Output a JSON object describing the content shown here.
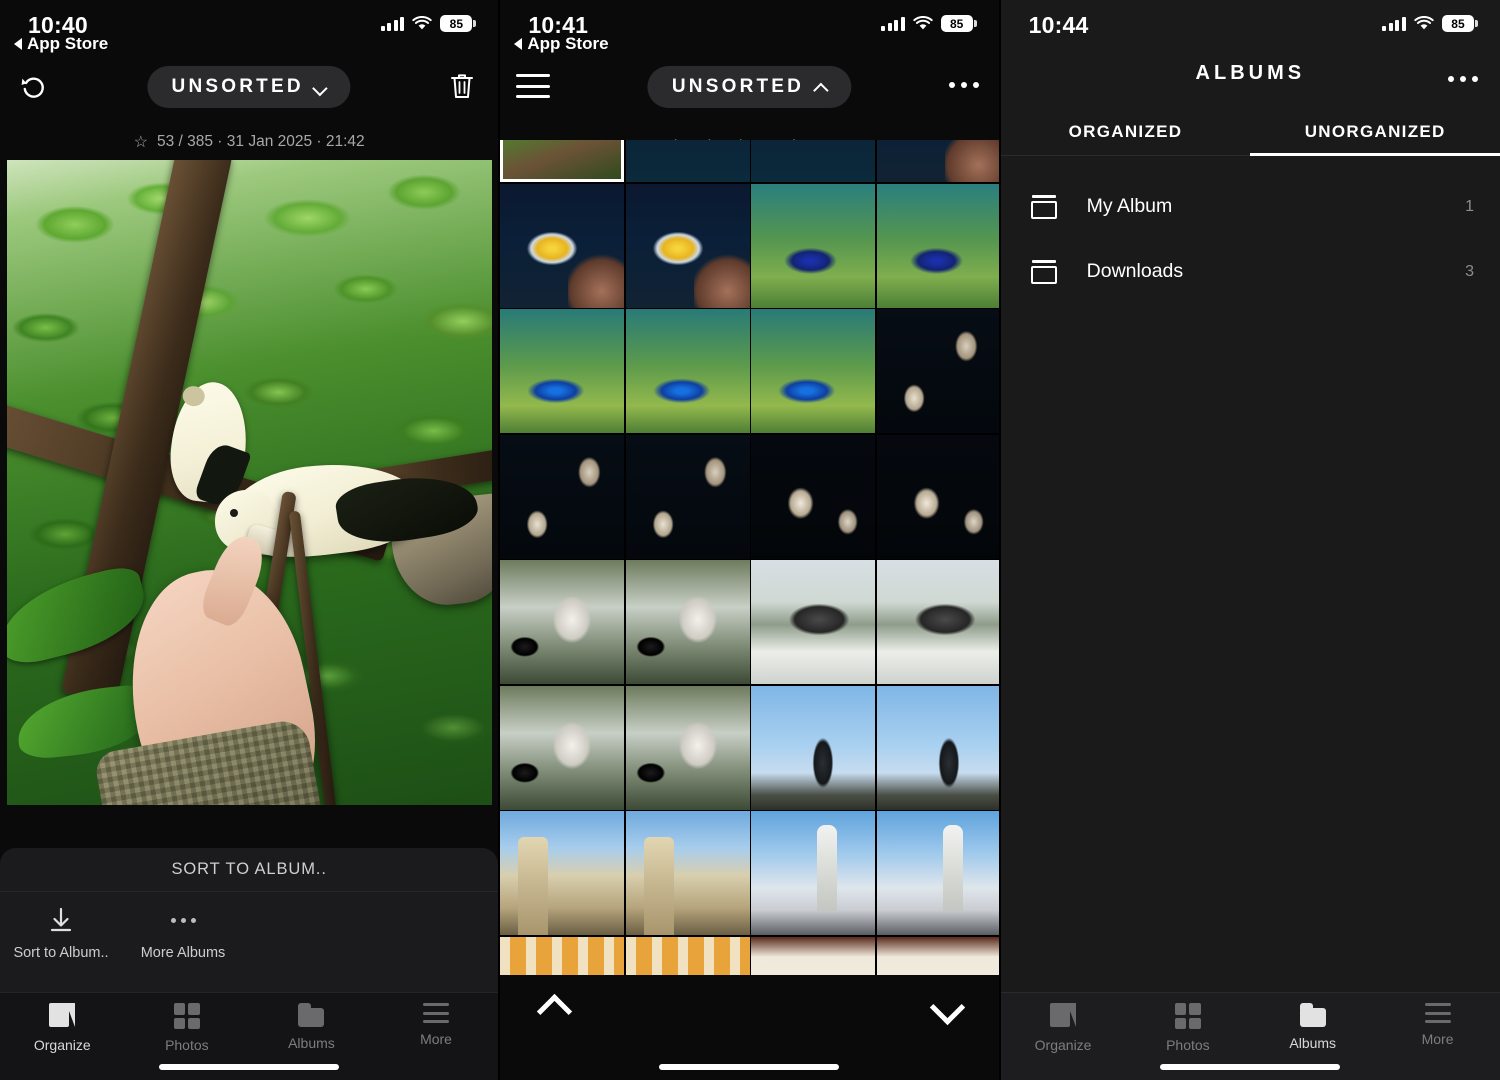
{
  "panels": [
    {
      "id": "organize",
      "status": {
        "time": "10:40",
        "back_label": "App Store",
        "battery": "85",
        "icons": [
          "cellular-signal-icon",
          "wifi-icon",
          "battery-icon"
        ]
      },
      "header": {
        "undo_icon": "undo-icon",
        "trash_icon": "trash-icon",
        "chip_label": "UNSORTED",
        "chip_chevron": "chevron-down-icon",
        "meta_star": "☆",
        "meta": "53 / 385 · 31 Jan 2025 · 21:42",
        "photo_index": "53",
        "photo_total": "385",
        "photo_date": "31 Jan 2025",
        "photo_time": "21:42"
      },
      "photo": {
        "alt": "white pied imperial pigeon on a branch being hand fed in green foliage"
      },
      "sort_panel": {
        "title": "SORT TO ALBUM..",
        "actions": [
          {
            "label": "Sort to Album..",
            "icon": "download-arrow-icon"
          },
          {
            "label": "More Albums",
            "icon": "ellipsis-icon"
          }
        ]
      },
      "tabbar": {
        "active": "Organize",
        "items": [
          {
            "label": "Organize",
            "icon": "organize-icon"
          },
          {
            "label": "Photos",
            "icon": "photos-grid-icon"
          },
          {
            "label": "Albums",
            "icon": "albums-folder-icon"
          },
          {
            "label": "More",
            "icon": "more-lines-icon"
          }
        ]
      }
    },
    {
      "id": "photos-grid",
      "status": {
        "time": "10:41",
        "back_label": "App Store",
        "battery": "85"
      },
      "header": {
        "menu_icon": "hamburger-icon",
        "chip_label": "UNSORTED",
        "chip_chevron": "chevron-up-icon",
        "kebab_icon": "ellipsis-icon",
        "hint": "Select the photo to jump to"
      },
      "grid": {
        "columns": 4,
        "selected_index": 0,
        "cells": [
          "t-forest",
          "t-coral",
          "t-coral",
          "t-fish1",
          "t-fish1",
          "t-fish1",
          "t-reef",
          "t-reef",
          "t-reef2",
          "t-reef2",
          "t-reef2",
          "t-jelly",
          "t-jelly",
          "t-jelly",
          "t-jelly2",
          "t-jelly2",
          "t-pelican",
          "t-pelican",
          "t-statue",
          "t-statue",
          "t-pelican",
          "t-pelican",
          "t-monument",
          "t-monument",
          "t-cathedral",
          "t-cathedral",
          "t-church",
          "t-church",
          "t-gold",
          "t-gold",
          "t-frame",
          "t-frame"
        ]
      },
      "footer": {
        "prev_icon": "chevron-up-icon",
        "next_icon": "chevron-down-icon"
      }
    },
    {
      "id": "albums",
      "status": {
        "time": "10:44",
        "battery": "85"
      },
      "header": {
        "title": "ALBUMS",
        "kebab_icon": "ellipsis-icon"
      },
      "tabs": [
        {
          "label": "ORGANIZED",
          "selected": false
        },
        {
          "label": "UNORGANIZED",
          "selected": true
        }
      ],
      "albums": [
        {
          "name": "My Album",
          "count": "1",
          "icon": "album-outline-icon"
        },
        {
          "name": "Downloads",
          "count": "3",
          "icon": "album-outline-icon"
        }
      ],
      "tabbar": {
        "active": "Albums",
        "items": [
          {
            "label": "Organize",
            "icon": "organize-icon"
          },
          {
            "label": "Photos",
            "icon": "photos-grid-icon"
          },
          {
            "label": "Albums",
            "icon": "albums-folder-icon"
          },
          {
            "label": "More",
            "icon": "more-lines-icon"
          }
        ]
      }
    }
  ],
  "colors": {
    "bg": "#0a0a0a",
    "panel3_bg": "#1a1a1a",
    "chip_bg": "#2b2b2e",
    "accent": "#ffffff"
  }
}
